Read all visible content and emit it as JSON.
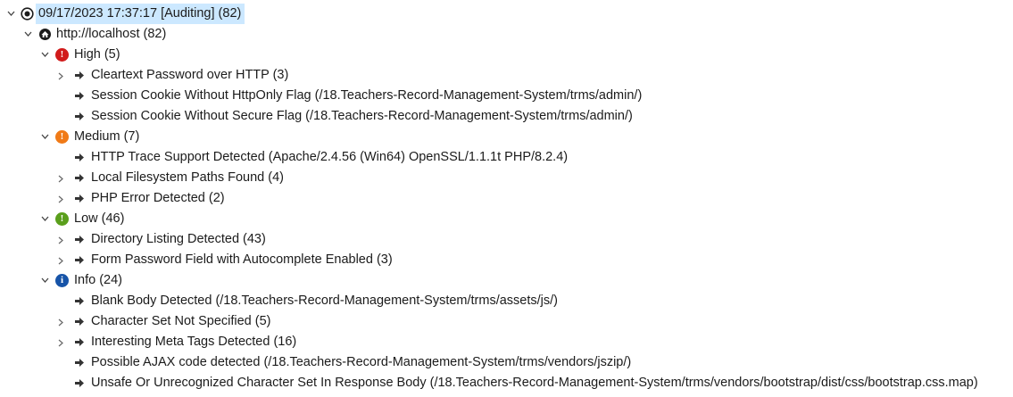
{
  "root": {
    "label": "09/17/2023 17:37:17 [Auditing]  (82)"
  },
  "host": {
    "label": "http://localhost (82)"
  },
  "groups": {
    "high": {
      "label": "High (5)",
      "color": "#d11b1b"
    },
    "medium": {
      "label": "Medium (7)",
      "color": "#f07a17"
    },
    "low": {
      "label": "Low (46)",
      "color": "#5a9f1c"
    },
    "info": {
      "label": "Info (24)",
      "color": "#1754a8"
    }
  },
  "items": [
    {
      "label": "Cleartext Password over HTTP (3)",
      "expandable": true
    },
    {
      "label": "Session Cookie Without HttpOnly Flag  (/18.Teachers-Record-Management-System/trms/admin/)",
      "expandable": false
    },
    {
      "label": "Session Cookie Without Secure Flag  (/18.Teachers-Record-Management-System/trms/admin/)",
      "expandable": false
    },
    {
      "label": "HTTP Trace Support Detected (Apache/2.4.56 (Win64) OpenSSL/1.1.1t PHP/8.2.4)",
      "expandable": false
    },
    {
      "label": "Local Filesystem Paths Found (4)",
      "expandable": true
    },
    {
      "label": "PHP Error Detected (2)",
      "expandable": true
    },
    {
      "label": "Directory Listing Detected (43)",
      "expandable": true
    },
    {
      "label": "Form Password Field with Autocomplete Enabled (3)",
      "expandable": true
    },
    {
      "label": "Blank Body Detected (/18.Teachers-Record-Management-System/trms/assets/js/)",
      "expandable": false
    },
    {
      "label": "Character Set Not Specified  (5)",
      "expandable": true
    },
    {
      "label": "Interesting Meta Tags Detected (16)",
      "expandable": true
    },
    {
      "label": "Possible AJAX code detected (/18.Teachers-Record-Management-System/trms/vendors/jszip/)",
      "expandable": false
    },
    {
      "label": "Unsafe Or Unrecognized Character Set In Response Body  (/18.Teachers-Record-Management-System/trms/vendors/bootstrap/dist/css/bootstrap.css.map)",
      "expandable": false
    }
  ],
  "icons": {
    "root": "target-icon",
    "host": "host-icon",
    "item": "arrow-right-icon",
    "expand": "chevron-right-icon",
    "collapse": "chevron-down-icon"
  }
}
